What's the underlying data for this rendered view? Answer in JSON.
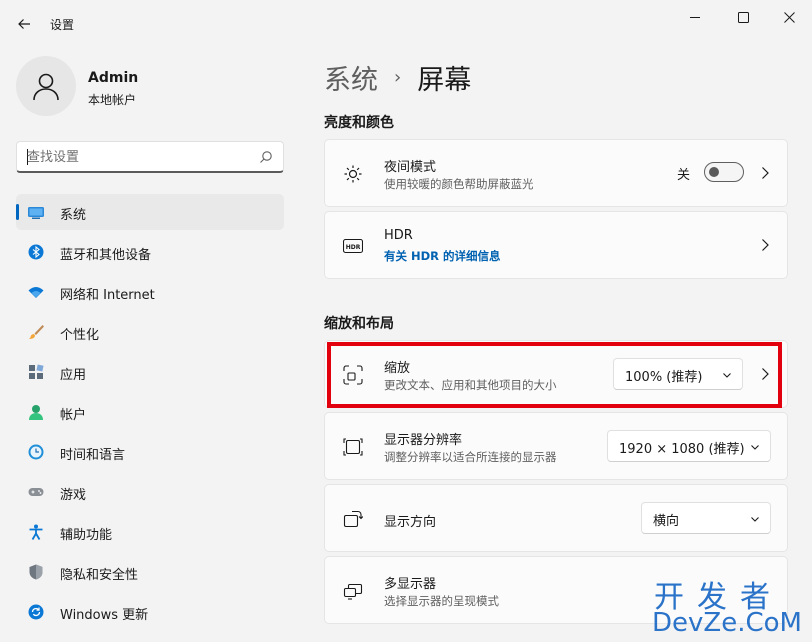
{
  "window": {
    "title": "设置",
    "back_icon": "arrow-left-icon",
    "controls": [
      "minimize-icon",
      "maximize-icon",
      "close-icon"
    ]
  },
  "profile": {
    "name": "Admin",
    "account_type": "本地帐户",
    "avatar_icon": "user-icon"
  },
  "search": {
    "placeholder": "查找设置",
    "icon": "search-icon"
  },
  "sidebar": {
    "items": [
      {
        "label": "系统",
        "icon": "monitor-icon",
        "active": true
      },
      {
        "label": "蓝牙和其他设备",
        "icon": "bluetooth-icon"
      },
      {
        "label": "网络和 Internet",
        "icon": "wifi-icon"
      },
      {
        "label": "个性化",
        "icon": "brush-icon"
      },
      {
        "label": "应用",
        "icon": "apps-icon"
      },
      {
        "label": "帐户",
        "icon": "account-icon"
      },
      {
        "label": "时间和语言",
        "icon": "clock-globe-icon"
      },
      {
        "label": "游戏",
        "icon": "gamepad-icon"
      },
      {
        "label": "辅助功能",
        "icon": "accessibility-icon"
      },
      {
        "label": "隐私和安全性",
        "icon": "shield-icon"
      },
      {
        "label": "Windows 更新",
        "icon": "update-icon"
      }
    ]
  },
  "main": {
    "breadcrumb": {
      "parent": "系统",
      "separator": "›",
      "current": "屏幕"
    },
    "sections": [
      {
        "title": "亮度和颜色",
        "cards": [
          {
            "title": "夜间模式",
            "subtitle": "使用较暖的颜色帮助屏蔽蓝光",
            "icon": "sun-icon",
            "toggle_label": "关",
            "toggle_on": false
          },
          {
            "title": "HDR",
            "subtitle": "有关 HDR 的详细信息",
            "icon": "hdr-icon"
          }
        ]
      },
      {
        "title": "缩放和布局",
        "cards": [
          {
            "title": "缩放",
            "subtitle": "更改文本、应用和其他项目的大小",
            "icon": "scale-icon",
            "select_value": "100% (推荐)"
          },
          {
            "title": "显示器分辨率",
            "subtitle": "调整分辨率以适合所连接的显示器",
            "icon": "resolution-icon",
            "select_value": "1920 × 1080 (推荐)"
          },
          {
            "title": "显示方向",
            "icon": "orientation-icon",
            "select_value": "横向"
          },
          {
            "title": "多显示器",
            "subtitle": "选择显示器的呈现模式",
            "icon": "multi-monitor-icon"
          }
        ]
      }
    ]
  },
  "watermark": {
    "line1": "开发者",
    "line2": "DevZe.CoM"
  },
  "colors": {
    "accent": "#0067c0",
    "highlight": "#e2000f",
    "link": "#0062b1",
    "watermark": "#2a73c9"
  }
}
